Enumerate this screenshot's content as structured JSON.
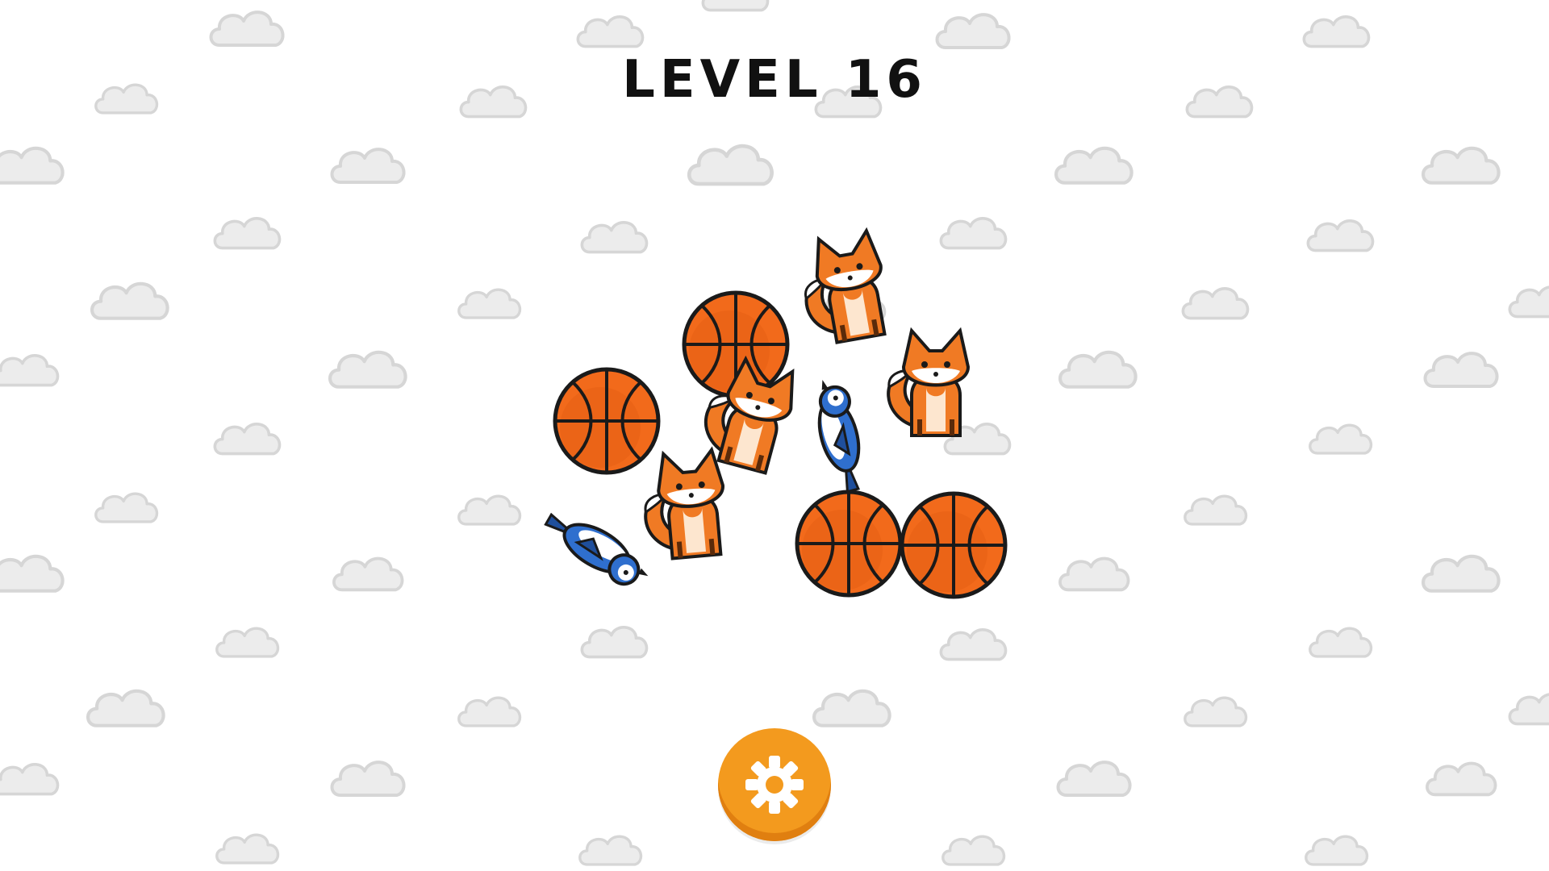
{
  "level_title": "LEVEL 16",
  "colors": {
    "background": "#ffffff",
    "cloud_fill": "#ececec",
    "cloud_stroke": "#d6d6d6",
    "ball": "#f26a1b",
    "ball_dark": "#d9520c",
    "fox": "#f07a24",
    "bird": "#2f6fce",
    "settings_button": "#f39a1e"
  },
  "icons": {
    "settings": "gear-icon"
  },
  "pile": {
    "pieces": [
      {
        "type": "basketball",
        "name": "basketball-piece"
      },
      {
        "type": "basketball",
        "name": "basketball-piece"
      },
      {
        "type": "basketball",
        "name": "basketball-piece"
      },
      {
        "type": "basketball",
        "name": "basketball-piece"
      },
      {
        "type": "fox",
        "name": "fox-piece"
      },
      {
        "type": "fox",
        "name": "fox-piece"
      },
      {
        "type": "fox",
        "name": "fox-piece"
      },
      {
        "type": "fox",
        "name": "fox-piece"
      },
      {
        "type": "blue_jay",
        "name": "blue-jay-piece"
      },
      {
        "type": "blue_jay",
        "name": "blue-jay-piece"
      }
    ]
  }
}
